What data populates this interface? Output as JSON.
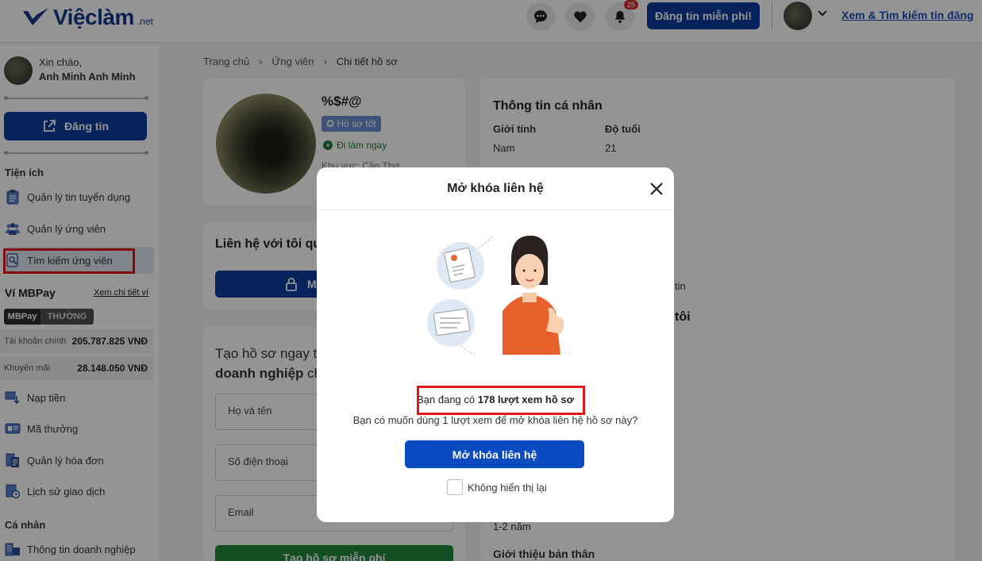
{
  "header": {
    "logo_text": "Việclàm",
    "logo_suffix": ".net",
    "notification_count": "25",
    "post_button": "Đăng tin miễn phí!",
    "search_link": "Xem & Tìm kiếm tin đăng"
  },
  "sidebar": {
    "greeting": "Xin chào,",
    "user_name": "Anh Minh Anh Minh",
    "post_button": "Đăng tin",
    "section_utilities": "Tiện ích",
    "items": [
      {
        "label": "Quản lý tin tuyển dụng",
        "icon": "clipboard-icon"
      },
      {
        "label": "Quản lý ứng viên",
        "icon": "people-icon"
      },
      {
        "label": "Tìm kiếm ứng viên",
        "icon": "search-profile-icon",
        "active": true
      }
    ],
    "wallet_title": "Ví MBPay",
    "wallet_link": "Xem chi tiết ví",
    "mbpay_logo": "MBPay",
    "mbpay_tier": "THƯỜNG",
    "main_account_label": "Tài khoản chính",
    "main_account_value": "205.787.825 VNĐ",
    "promo_label": "Khuyến mãi",
    "promo_value": "28.148.050 VNĐ",
    "wallet_items": [
      {
        "label": "Nạp tiền",
        "icon": "deposit-icon"
      },
      {
        "label": "Mã thưởng",
        "icon": "voucher-icon"
      },
      {
        "label": "Quản lý hóa đơn",
        "icon": "invoice-icon"
      },
      {
        "label": "Lịch sử giao dịch",
        "icon": "history-icon"
      }
    ],
    "section_personal": "Cá nhân",
    "personal_items": [
      {
        "label": "Thông tin doanh nghiệp",
        "icon": "company-icon"
      }
    ]
  },
  "breadcrumb": [
    "Trang chủ",
    "Ứng viên",
    "Chi tiết hồ sơ"
  ],
  "profile": {
    "name": "%$#@",
    "tag": "Hồ sơ tốt",
    "status": "Đi làm ngay",
    "region": "Khu vực: Cần Thơ"
  },
  "contact": {
    "title": "Liên hệ với tôi qua",
    "unlock_label": "Mở khóa"
  },
  "cta": {
    "line1": "Tạo hồ sơ ngay tiếp cận",
    "line2_bold": "doanh nghiệp",
    "line2_rest": " chỉ",
    "name_placeholder": "Họ và tên",
    "phone_placeholder": "Số điện thoại",
    "email_placeholder": "Email",
    "submit": "Tạo hồ sơ miễn phí"
  },
  "personal_info": {
    "title": "Thông tin cá nhân",
    "gender_label": "Giới tính",
    "gender_value": "Nam",
    "age_label": "Độ tuổi",
    "age_value": "21",
    "partial_text": "tin",
    "partial_heading": "tôi",
    "experience_value": "1-2 năm",
    "about_label": "Giới thiệu bản thân"
  },
  "modal": {
    "title": "Mở khóa liên hệ",
    "views_prefix": "Bạn đang có ",
    "views_count": "178 lượt xem hồ sơ",
    "question": "Bạn có muốn dùng 1 lượt xem để mở khóa liên hệ hồ sơ này?",
    "unlock_button": "Mở khóa liên hệ",
    "dont_show": "Không hiển thị lại"
  },
  "colors": {
    "brand_blue": "#0b3f9e",
    "modal_button": "#0b4bc2",
    "highlight_red": "#e0181b",
    "green_button": "#1f8a3e"
  }
}
